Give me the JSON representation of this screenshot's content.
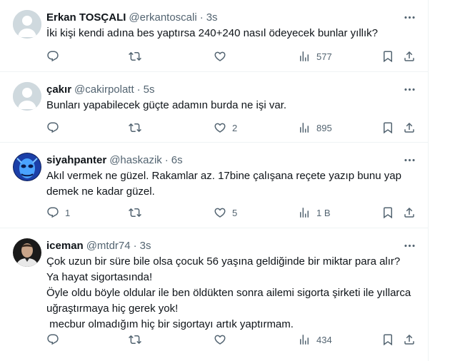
{
  "tweets": [
    {
      "name": "Erkan TOSÇALI",
      "handle": "@erkantoscali",
      "separator": "·",
      "time": "3s",
      "text": "İki kişi kendi adına bes yaptırsa 240+240 nasıl ödeyecek bunlar yıllık?",
      "replies": "",
      "retweets": "",
      "likes": "",
      "views": "577",
      "avatar_icon": "default-avatar-icon"
    },
    {
      "name": "çakır",
      "handle": "@cakirpolatt",
      "separator": "·",
      "time": "5s",
      "text": "Bunları yapabilecek güçte adamın burda ne işi var.",
      "replies": "",
      "retweets": "",
      "likes": "2",
      "views": "895",
      "avatar_icon": "default-avatar-icon"
    },
    {
      "name": "siyahpanter",
      "handle": "@haskazik",
      "separator": "·",
      "time": "6s",
      "text": "Akıl vermek ne güzel. Rakamlar az. 17bine çalışana reçete yazıp bunu yap demek ne kadar güzel.",
      "replies": "1",
      "retweets": "",
      "likes": "5",
      "views": "1 B",
      "avatar_icon": "blue-mask-avatar"
    },
    {
      "name": "iceman",
      "handle": "@mtdr74",
      "separator": "·",
      "time": "3s",
      "text": "Çok uzun bir süre bile olsa çocuk 56 yaşına geldiğinde bir miktar para alır?\nYa hayat sigortasında!\nÖyle oldu böyle oldular ile ben öldükten sonra ailemi sigorta şirketi ile yıllarca uğraştırmaya hiç gerek yok!\n mecbur olmadığım hiç bir sigortayı artık yaptırmam.",
      "replies": "",
      "retweets": "",
      "likes": "",
      "views": "434",
      "avatar_icon": "man-photo-avatar"
    }
  ],
  "colors": {
    "text": "#0f1419",
    "secondary": "#536471",
    "border": "#eff3f4",
    "default_avatar": "#cfd9de"
  }
}
